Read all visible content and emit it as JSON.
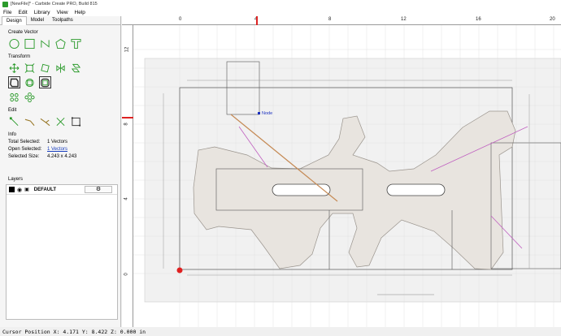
{
  "window": {
    "title": "[NewFile]* - Carbide Create PRO, Build 815"
  },
  "menu": [
    "File",
    "Edit",
    "Library",
    "View",
    "Help"
  ],
  "tabs": [
    {
      "label": "Design",
      "active": true
    },
    {
      "label": "Model",
      "active": false
    },
    {
      "label": "Toolpaths",
      "active": false
    }
  ],
  "sections": {
    "create_vector": "Create Vector",
    "transform": "Transform",
    "edit": "Edit",
    "info": "Info",
    "layers": "Layers"
  },
  "info": {
    "total_selected_label": "Total Selected:",
    "total_selected_value": "1 Vectors",
    "open_selected_label": "Open Selected:",
    "open_selected_value": "1 Vectors",
    "selected_size_label": "Selected Size:",
    "selected_size_value": "4.243 x 4.243"
  },
  "layers": [
    {
      "name": "DEFAULT",
      "color": "#000000"
    }
  ],
  "ruler": {
    "top": [
      "0",
      "4",
      "8",
      "12",
      "16",
      "20"
    ],
    "left": [
      "12",
      "8",
      "4",
      "0"
    ]
  },
  "node_label": "Node",
  "status": "Cursor Position X: 4.171 Y: 8.422 Z: 0.000 in",
  "colors": {
    "accent": "#2b9a2b",
    "selection": "#c060c0",
    "active_vector": "#c58a55",
    "shape_fill": "#e8e4df"
  }
}
